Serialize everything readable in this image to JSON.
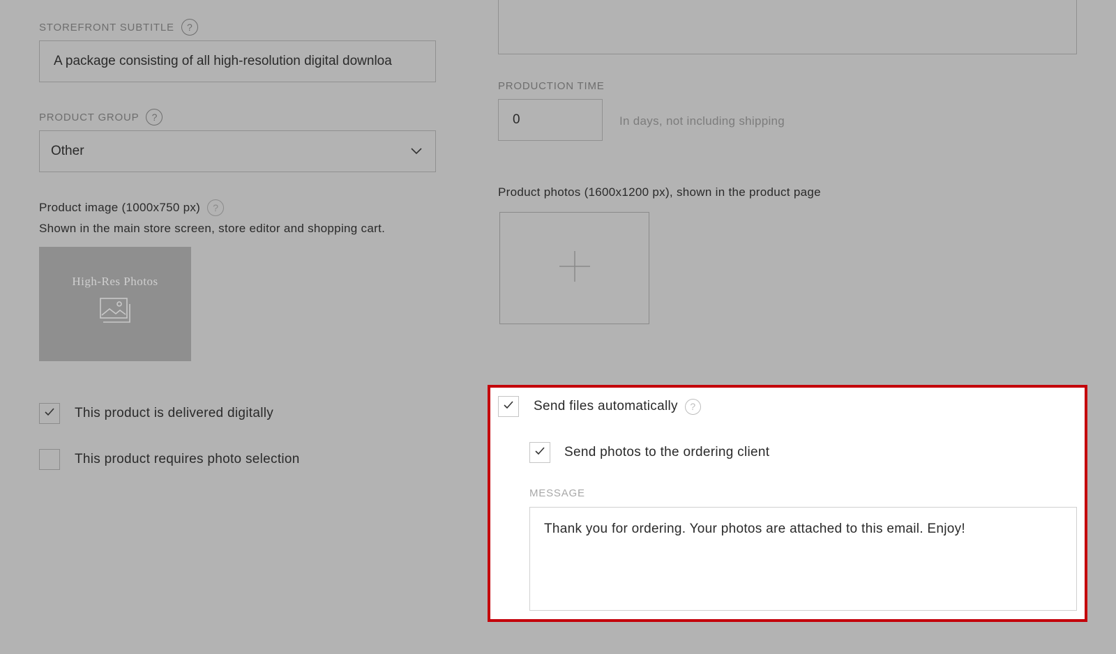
{
  "storefront_subtitle": {
    "label": "STOREFRONT SUBTITLE",
    "value": "A package consisting of all high-resolution digital downloa"
  },
  "product_group": {
    "label": "PRODUCT GROUP",
    "selected": "Other"
  },
  "product_image": {
    "title": "Product image (1000x750 px)",
    "description": "Shown in the main store screen, store editor and shopping cart.",
    "thumbnail_text": "High-Res Photos"
  },
  "checkboxes_left": [
    {
      "label": "This product is delivered digitally",
      "checked": true
    },
    {
      "label": "This product requires photo selection",
      "checked": false
    }
  ],
  "production_time": {
    "label": "PRODUCTION TIME",
    "value": "0",
    "hint": "In days, not including shipping"
  },
  "product_photos": {
    "title": "Product photos (1600x1200 px), shown in the product page"
  },
  "send_files": {
    "label": "Send files automatically",
    "checked": true,
    "send_to_client": {
      "label": "Send photos to the ordering client",
      "checked": true
    },
    "message": {
      "label": "MESSAGE",
      "value": "Thank you for ordering. Your photos are attached to this email. Enjoy!"
    }
  },
  "help_glyph": "?",
  "icons": {
    "check": "checkmark-icon",
    "chevron": "chevron-down-icon",
    "plus": "plus-icon",
    "image": "image-placeholder-icon",
    "help": "help-icon"
  },
  "colors": {
    "background": "#b3b3b3",
    "highlight_border": "#c4000a",
    "thumbnail_bg": "#8f8f8f"
  }
}
